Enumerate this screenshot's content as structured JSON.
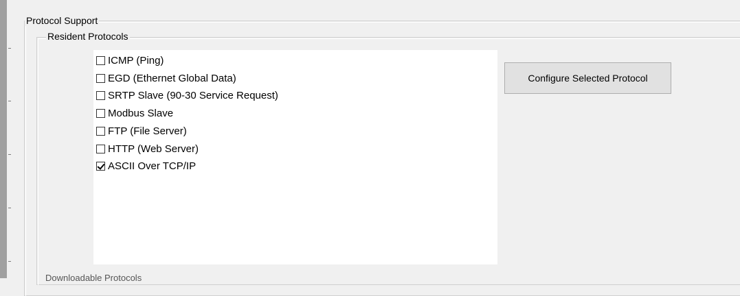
{
  "groups": {
    "protocol_support": "Protocol Support",
    "resident_protocols": "Resident Protocols"
  },
  "protocols": [
    {
      "label": "ICMP (Ping)",
      "checked": false
    },
    {
      "label": "EGD (Ethernet Global Data)",
      "checked": false
    },
    {
      "label": "SRTP Slave (90-30 Service Request)",
      "checked": false
    },
    {
      "label": "Modbus Slave",
      "checked": false
    },
    {
      "label": "FTP (File Server)",
      "checked": false
    },
    {
      "label": "HTTP (Web Server)",
      "checked": false
    },
    {
      "label": "ASCII Over TCP/IP",
      "checked": true
    }
  ],
  "buttons": {
    "configure": "Configure Selected Protocol"
  },
  "truncated_group_label": "Downloadable Protocols"
}
